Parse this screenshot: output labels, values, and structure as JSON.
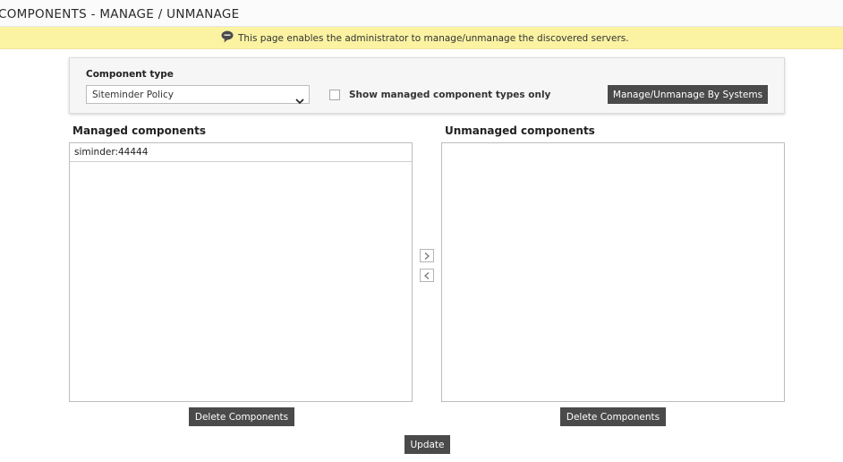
{
  "page": {
    "title": "COMPONENTS - MANAGE / UNMANAGE"
  },
  "banner": {
    "icon": "speech-bubble-icon",
    "text": "This page enables the administrator to manage/unmanage the discovered servers."
  },
  "component_type": {
    "label": "Component type",
    "selected": "Siteminder Policy",
    "show_managed_label": "Show managed component types only",
    "show_managed_checked": false,
    "systems_button": "Manage/Unmanage By Systems"
  },
  "managed": {
    "heading": "Managed components",
    "items": [
      {
        "label": "siminder:44444"
      }
    ],
    "delete_button": "Delete Components"
  },
  "unmanaged": {
    "heading": "Unmanaged components",
    "items": [],
    "delete_button": "Delete Components"
  },
  "actions": {
    "update_button": "Update"
  },
  "colors": {
    "banner_bg": "#fbf3a2",
    "button_bg": "#4a4a4a",
    "panel_bg": "#f6f6f6"
  }
}
